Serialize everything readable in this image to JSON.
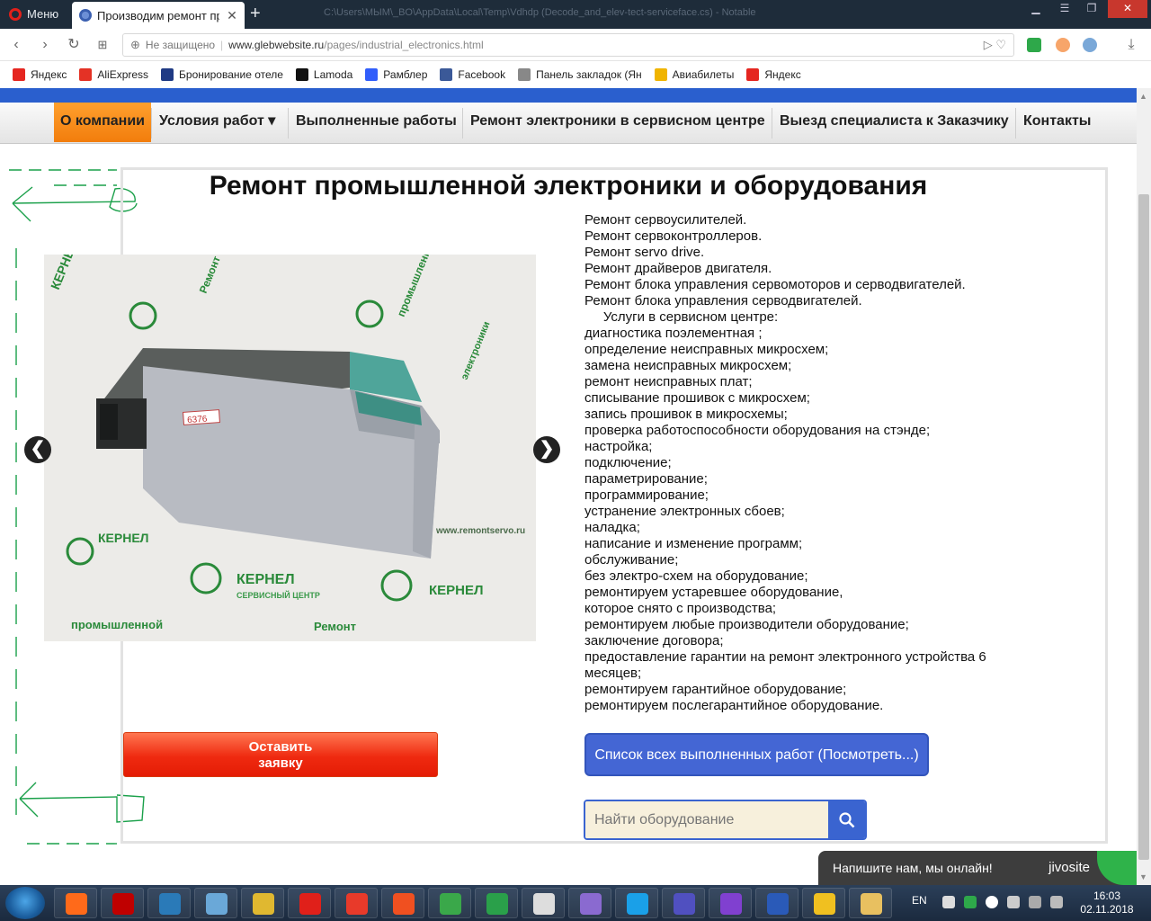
{
  "browser": {
    "menu_label": "Меню",
    "tab_title": "Производим ремонт про",
    "tab_close": "✕",
    "new_tab": "+",
    "url_security": "Не защищено",
    "url_host": "www.glebwebsite.ru",
    "url_path": "/pages/industrial_electronics.html",
    "path_ghost": "C:\\Users\\МЫМ\\_BO\\AppData\\Local\\Temp\\Vdhdp (Decode_and_elev-tect-serviceface.cs) - Notable"
  },
  "bookmarks": [
    {
      "label": "Яндекс",
      "icon": "yandex-icon",
      "color": "#e52620"
    },
    {
      "label": "AliExpress",
      "icon": "aliexpress-icon",
      "color": "#e43225"
    },
    {
      "label": "Бронирование отеле",
      "icon": "booking-icon",
      "color": "#1f3a84"
    },
    {
      "label": "Lamoda",
      "icon": "lamoda-icon",
      "color": "#111111"
    },
    {
      "label": "Рамблер",
      "icon": "rambler-icon",
      "color": "#315efb"
    },
    {
      "label": "Facebook",
      "icon": "facebook-icon",
      "color": "#3b5998"
    },
    {
      "label": "Панель закладок (Ян",
      "icon": "folder-icon",
      "color": "#888888"
    },
    {
      "label": "Авиабилеты",
      "icon": "plane-icon",
      "color": "#f0b400"
    },
    {
      "label": "Яндекс",
      "icon": "yandex-icon",
      "color": "#e52620"
    }
  ],
  "nav": [
    {
      "label": "О компании",
      "active": true
    },
    {
      "label": "Условия работ ▾",
      "active": false
    },
    {
      "label": "Выполненные работы",
      "active": false
    },
    {
      "label": "Ремонт электроники в сервисном центре",
      "active": false
    },
    {
      "label": "Выезд специалиста к Заказчику",
      "active": false
    },
    {
      "label": "Контакты",
      "active": false
    }
  ],
  "page": {
    "title": "Ремонт промышленной электроники и оборудования",
    "slider_prev": "❮",
    "slider_next": "❯",
    "photo_label": "6376",
    "watermark_brand": "КЕРНЕЛ",
    "watermark_sub": "СЕРВИСНЫЙ ЦЕНТР",
    "watermark_repair": "Ремонт",
    "watermark_promo": "промышленной",
    "watermark_elec": "электроники",
    "watermark_site": "www.remontservo.ru"
  },
  "services": [
    "Ремонт сервоусилителей.",
    "Ремонт сервоконтроллеров.",
    "Ремонт servo drive.",
    "Ремонт драйверов двигателя.",
    "Ремонт блока управления сервомоторов и серводвигателей.",
    "Ремонт блока управления серводвигателей.",
    "     Услуги в сервисном центре:",
    "диагностика поэлементная ;",
    "определение неисправных микросхем;",
    "замена неисправных микросхем;",
    "ремонт неисправных плат;",
    "списывание прошивок с микросхем;",
    "запись прошивок в микросхемы;",
    "проверка работоспособности оборудования на стэнде;",
    "настройка;",
    "подключение;",
    "параметрирование;",
    "программирование;",
    "устранение электронных сбоев;",
    "наладка;",
    "написание и изменение программ;",
    "обслуживание;",
    "без электро-схем на оборудование;",
    "ремонтируем устаревшее оборудование,",
    "которое снято с производства;",
    "ремонтируем любые производители оборудование;",
    "заключение договора;",
    "предоставление гарантии на ремонт электронного устройства 6 месяцев;",
    "ремонтируем гарантийное оборудование;",
    "ремонтируем послегарантийное оборудование."
  ],
  "buttons": {
    "order_line1": "Оставить",
    "order_line2": "заявку",
    "works": "Список всех выполненных работ (Посмотреть...)",
    "search_placeholder": "Найти оборудование"
  },
  "chat": {
    "text": "Напишите нам, мы онлайн!",
    "brand": "jivosite"
  },
  "taskbar": {
    "lang": "EN",
    "time": "16:03",
    "date": "02.11.2018",
    "apps": [
      {
        "name": "firefox-icon",
        "color": "#ff6a1a"
      },
      {
        "name": "filezilla-icon",
        "color": "#bf0000"
      },
      {
        "name": "brackets-icon",
        "color": "#2a7ab8"
      },
      {
        "name": "notepad-icon",
        "color": "#6aa8d8"
      },
      {
        "name": "chrome-icon",
        "color": "#e0b830"
      },
      {
        "name": "opera-icon",
        "color": "#e0201a"
      },
      {
        "name": "yandex-browser-icon",
        "color": "#e83a2a"
      },
      {
        "name": "brave-icon",
        "color": "#f05020"
      },
      {
        "name": "globe-icon",
        "color": "#3aa84a"
      },
      {
        "name": "jivo-icon",
        "color": "#2aa04a"
      },
      {
        "name": "font-icon",
        "color": "#dddddd"
      },
      {
        "name": "cat-icon",
        "color": "#8a6ad0"
      },
      {
        "name": "skype-icon",
        "color": "#1aa0e8"
      },
      {
        "name": "save-icon",
        "color": "#5050c0"
      },
      {
        "name": "wolf-icon",
        "color": "#8040d0"
      },
      {
        "name": "w-icon",
        "color": "#2a5ab8"
      },
      {
        "name": "stack-icon",
        "color": "#f0c020"
      },
      {
        "name": "explorer-icon",
        "color": "#e8c060"
      }
    ]
  }
}
